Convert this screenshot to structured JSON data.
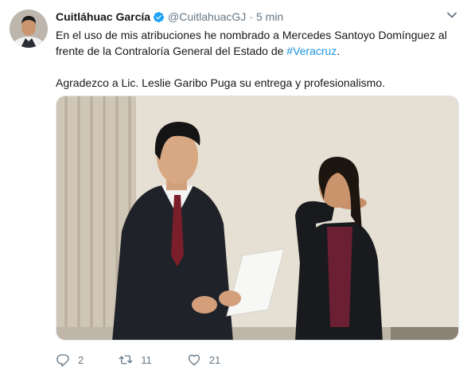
{
  "tweet": {
    "author_name": "Cuitláhuac García",
    "handle": "@CuitlahuacGJ",
    "separator": "·",
    "time": "5 min",
    "text_line1_before": "En el uso de mis atribuciones he nombrado a Mercedes Santoyo Domínguez al frente de la Contraloría General del Estado de ",
    "hashtag": "#Veracruz",
    "text_line1_after": ".",
    "text_paragraph2": "Agradezco a Lic. Leslie Garibo Puga su entrega y profesionalismo.",
    "counts": {
      "replies": "2",
      "retweets": "11",
      "likes": "21"
    }
  },
  "icons": {
    "verified": "verified-badge-icon",
    "caret": "chevron-down-icon",
    "reply": "reply-icon",
    "retweet": "retweet-icon",
    "like": "heart-icon"
  },
  "colors": {
    "link": "#1b95e0",
    "muted": "#657786",
    "verified": "#1da1f2"
  }
}
